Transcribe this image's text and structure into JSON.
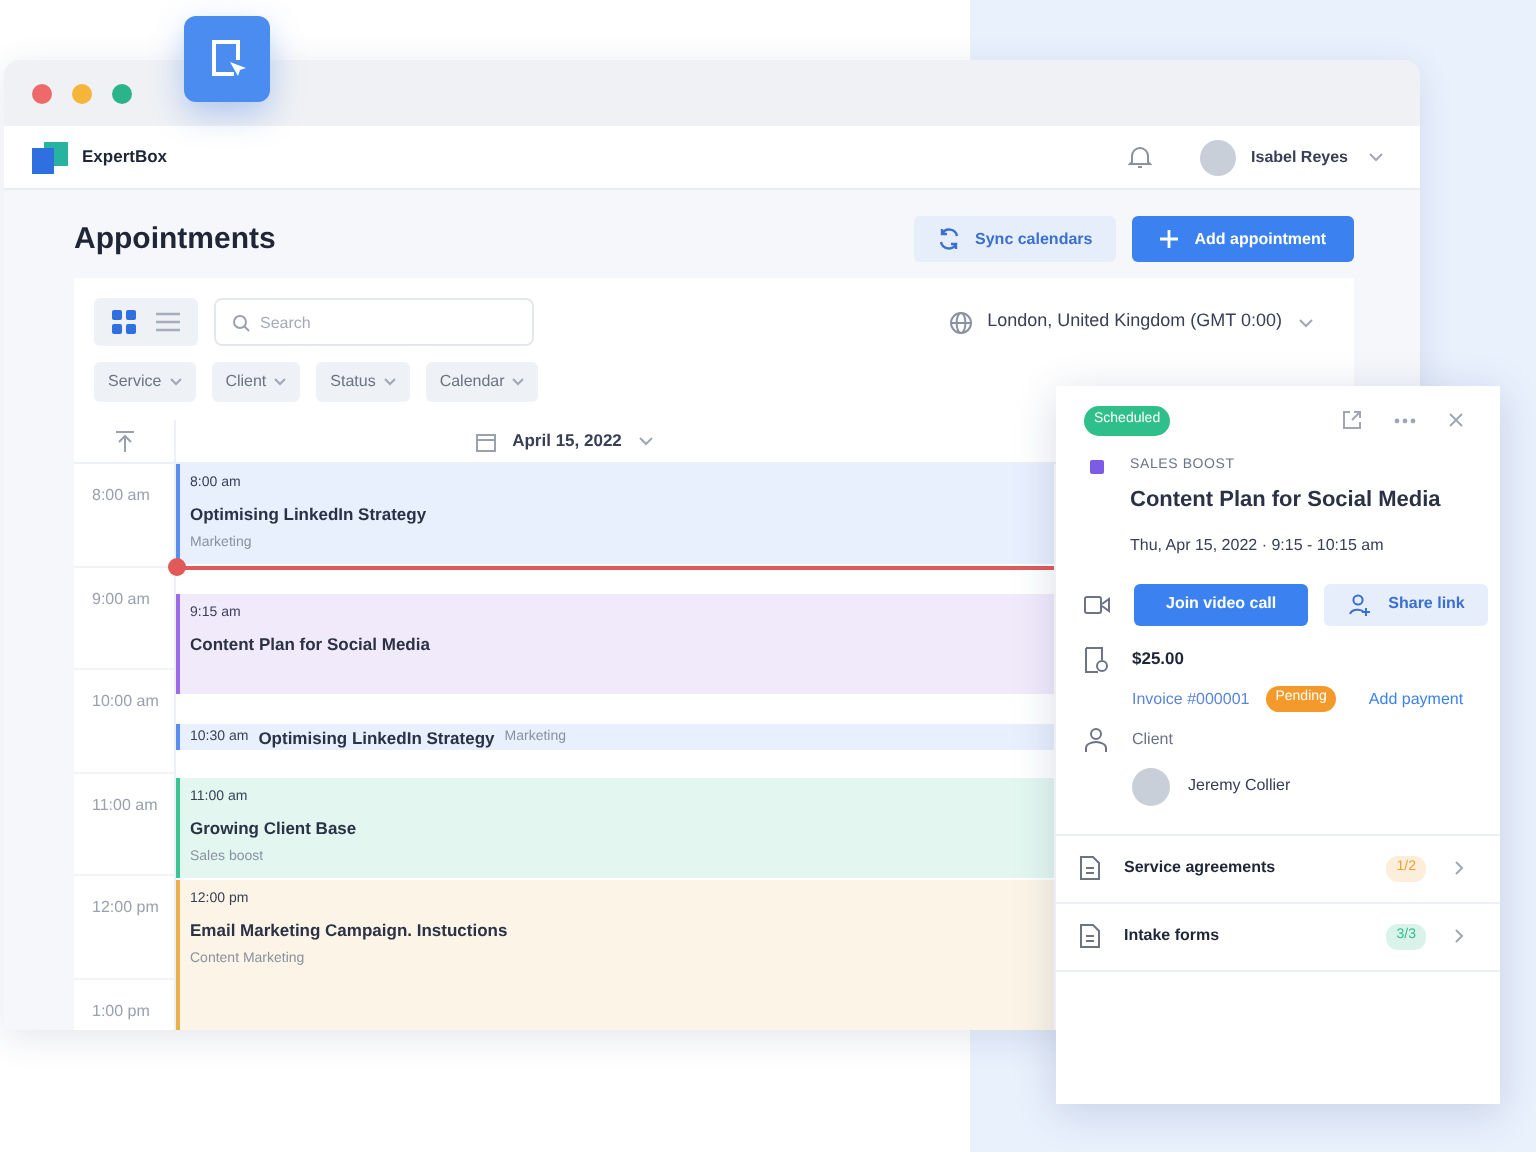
{
  "header": {
    "brand": "ExpertBox",
    "user": "Isabel Reyes"
  },
  "page": {
    "title": "Appointments",
    "buttons": [
      {
        "label": "Sync calendars",
        "kind": "secondary"
      },
      {
        "label": "Add appointment",
        "kind": "primary"
      }
    ]
  },
  "toolbar": {
    "views": [
      {
        "kind": "grid",
        "selected": true
      },
      {
        "kind": "list",
        "selected": false
      }
    ],
    "search": {
      "placeholder": "Search"
    },
    "timezone": "London, United Kingdom (GMT 0:00)",
    "filters": [
      "Service",
      "Client",
      "Status",
      "Calendar"
    ]
  },
  "calendar": {
    "date": "April 15, 2022",
    "times": [
      "8:00 am",
      "9:00 am",
      "10:00 am",
      "11:00 am",
      "12:00 pm",
      "1:00 pm"
    ],
    "events": [
      {
        "kind": "block",
        "time": "8:00 am",
        "title": "Optimising LinkedIn Strategy",
        "category": "Marketing",
        "color": "#5b8def"
      },
      {
        "kind": "block",
        "time": "9:15 am",
        "title": "Content Plan for Social Media",
        "color": "#9b6ce6"
      },
      {
        "kind": "compact",
        "time": "10:30 am",
        "title": "Optimising LinkedIn Strategy",
        "category": "Marketing",
        "color": "#5b8def"
      },
      {
        "kind": "block",
        "time": "11:00 am",
        "title": "Growing Client Base",
        "category": "Sales boost",
        "color": "#3cc495"
      },
      {
        "kind": "block",
        "time": "12:00 pm",
        "title": "Email Marketing Campaign. Instuctions",
        "category": "Content Marketing",
        "color": "#e8b04e"
      }
    ]
  },
  "details": {
    "status": "Scheduled",
    "category": "SALES BOOST",
    "color": "#7c5ce6",
    "title": "Content Plan for Social Media",
    "when": "Thu, Apr 15, 2022  ·  9:15 - 10:15 am",
    "buttons": [
      {
        "label": "Join video call",
        "kind": "primary"
      },
      {
        "label": "Share link",
        "kind": "secondary"
      }
    ],
    "price": "$25.00",
    "invoice": "Invoice #000001",
    "payment_status": "Pending",
    "payment_action": "Add payment",
    "client_label": "Client",
    "client": "Jeremy Collier",
    "sections": [
      {
        "label": "Service agreements",
        "count": "1/2",
        "color": "#f0a030"
      },
      {
        "label": "Intake forms",
        "count": "3/3",
        "color": "#2fbf8a"
      }
    ]
  }
}
